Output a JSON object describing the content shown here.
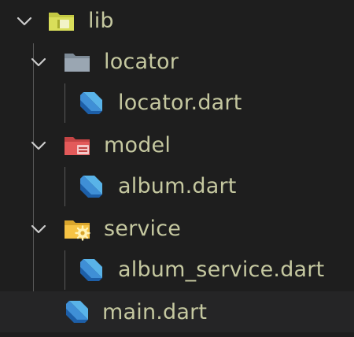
{
  "explorer": {
    "root": {
      "label": "lib",
      "expanded": true,
      "icon": "folder-lib-icon",
      "icon_color": "#c3c843"
    },
    "folders": [
      {
        "label": "locator",
        "expanded": true,
        "icon": "folder-icon",
        "icon_color": "#9aa6b2",
        "files": [
          {
            "label": "locator.dart",
            "icon": "dart-file-icon"
          }
        ]
      },
      {
        "label": "model",
        "expanded": true,
        "icon": "folder-database-icon",
        "icon_color": "#e35a5a",
        "files": [
          {
            "label": "album.dart",
            "icon": "dart-file-icon"
          }
        ]
      },
      {
        "label": "service",
        "expanded": true,
        "icon": "folder-settings-icon",
        "icon_color": "#f6c344",
        "files": [
          {
            "label": "album_service.dart",
            "icon": "dart-file-icon"
          }
        ]
      }
    ],
    "files": [
      {
        "label": "main.dart",
        "icon": "dart-file-icon"
      }
    ]
  },
  "colors": {
    "background": "#1e1e1e",
    "hover_row": "#252526",
    "text": "#c5c8a0",
    "chevron": "#cccccc",
    "dart_light": "#59b3e8",
    "dart_dark": "#1d5fa8"
  }
}
